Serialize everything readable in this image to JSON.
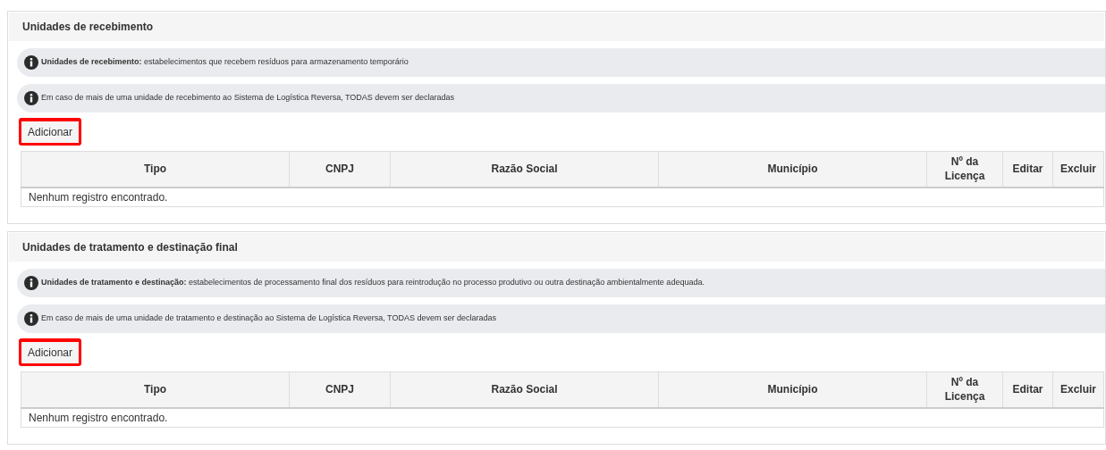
{
  "sections": [
    {
      "title": "Unidades de recebimento",
      "notes": [
        "**Unidades de recebimento:** estabelecimentos que recebem resíduos para armazenamento temporário",
        "Em caso de mais de uma unidade de recebimento ao Sistema de Logística Reversa, TODAS devem ser declaradas"
      ],
      "add_button": {
        "label": "Adicionar",
        "highlighted": true
      },
      "table": {
        "columns": [
          "Tipo",
          "CNPJ",
          "Razão Social",
          "Município",
          "Nº da Licença",
          "Editar",
          "Excluir"
        ],
        "empty_message": "Nenhum registro encontrado."
      }
    },
    {
      "title": "Unidades de tratamento e destinação final",
      "notes": [
        "**Unidades de tratamento e destinação:** estabelecimentos de processamento final dos resíduos para reintrodução no processo produtivo ou outra destinação ambientalmente adequada.",
        "Em caso de mais de uma unidade de tratamento e destinação ao Sistema de Logística Reversa, TODAS devem ser declaradas"
      ],
      "add_button": {
        "label": "Adicionar",
        "highlighted": true
      },
      "table": {
        "columns": [
          "Tipo",
          "CNPJ",
          "Razão Social",
          "Município",
          "Nº da Licença",
          "Editar",
          "Excluir"
        ],
        "empty_message": "Nenhum registro encontrado."
      }
    }
  ]
}
